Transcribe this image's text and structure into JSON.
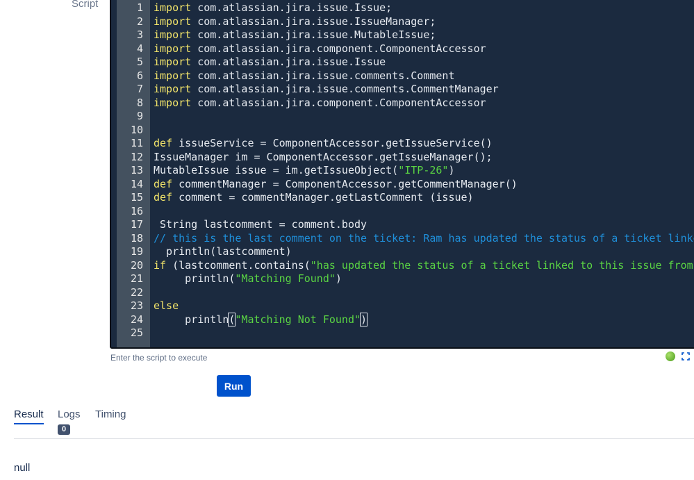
{
  "script_label": "Script",
  "editor": {
    "lines": [
      {
        "n": "1",
        "t": [
          [
            "kw",
            "import"
          ],
          [
            "pl",
            " com.atlassian.jira.issue.Issue;"
          ]
        ]
      },
      {
        "n": "2",
        "t": [
          [
            "kw",
            "import"
          ],
          [
            "pl",
            " com.atlassian.jira.issue.IssueManager;"
          ]
        ]
      },
      {
        "n": "3",
        "t": [
          [
            "kw",
            "import"
          ],
          [
            "pl",
            " com.atlassian.jira.issue.MutableIssue;"
          ]
        ]
      },
      {
        "n": "4",
        "t": [
          [
            "kw",
            "import"
          ],
          [
            "pl",
            " com.atlassian.jira.component.ComponentAccessor"
          ]
        ]
      },
      {
        "n": "5",
        "t": [
          [
            "kw",
            "import"
          ],
          [
            "pl",
            " com.atlassian.jira.issue.Issue"
          ]
        ]
      },
      {
        "n": "6",
        "t": [
          [
            "kw",
            "import"
          ],
          [
            "pl",
            " com.atlassian.jira.issue.comments.Comment"
          ]
        ]
      },
      {
        "n": "7",
        "t": [
          [
            "kw",
            "import"
          ],
          [
            "pl",
            " com.atlassian.jira.issue.comments.CommentManager"
          ]
        ]
      },
      {
        "n": "8",
        "t": [
          [
            "kw",
            "import"
          ],
          [
            "pl",
            " com.atlassian.jira.component.ComponentAccessor"
          ]
        ]
      },
      {
        "n": "9",
        "t": []
      },
      {
        "n": "10",
        "t": []
      },
      {
        "n": "11",
        "t": [
          [
            "kw",
            "def"
          ],
          [
            "pl",
            " issueService = ComponentAccessor.getIssueService()"
          ]
        ]
      },
      {
        "n": "12",
        "t": [
          [
            "pl",
            "IssueManager im = ComponentAccessor.getIssueManager();"
          ]
        ]
      },
      {
        "n": "13",
        "t": [
          [
            "pl",
            "MutableIssue issue = im.getIssueObject("
          ],
          [
            "str",
            "\"ITP-26\""
          ],
          [
            "pl",
            ")"
          ]
        ]
      },
      {
        "n": "14",
        "t": [
          [
            "kw",
            "def"
          ],
          [
            "pl",
            " commentManager = ComponentAccessor.getCommentManager()"
          ]
        ]
      },
      {
        "n": "15",
        "t": [
          [
            "kw",
            "def"
          ],
          [
            "pl",
            " comment = commentManager.getLastComment (issue)"
          ]
        ]
      },
      {
        "n": "16",
        "t": []
      },
      {
        "n": "17",
        "t": [
          [
            "pl",
            " String lastcomment = comment.body"
          ]
        ]
      },
      {
        "n": "18",
        "t": [
          [
            "cm",
            "// this is the last comment on the ticket: Ram has updated the status of a ticket linked to"
          ]
        ]
      },
      {
        "n": "19",
        "t": [
          [
            "pl",
            "  println(lastcomment)"
          ]
        ]
      },
      {
        "n": "20",
        "t": [
          [
            "kw",
            "if"
          ],
          [
            "pl",
            " (lastcomment.contains("
          ],
          [
            "str",
            "\"has updated the status of a ticket linked to this issue from [Ope"
          ]
        ]
      },
      {
        "n": "21",
        "t": [
          [
            "pl",
            "     println("
          ],
          [
            "str",
            "\"Matching Found\""
          ],
          [
            "pl",
            ")"
          ]
        ]
      },
      {
        "n": "22",
        "t": []
      },
      {
        "n": "23",
        "t": [
          [
            "kw",
            "else"
          ]
        ]
      },
      {
        "n": "24",
        "t": [
          [
            "pl",
            "     println"
          ],
          [
            "cursor",
            "("
          ],
          [
            "str",
            "\"Matching Not Found\""
          ],
          [
            "cursor",
            ")"
          ]
        ]
      },
      {
        "n": "25",
        "t": []
      }
    ]
  },
  "helper_text": "Enter the script to execute",
  "run_label": "Run",
  "tabs": [
    {
      "label": "Result",
      "active": true
    },
    {
      "label": "Logs",
      "active": false,
      "badge": "0"
    },
    {
      "label": "Timing",
      "active": false
    }
  ],
  "result_value": "null",
  "colors": {
    "editor_bg": "#1b2a3f",
    "keyword": "#f2e46a",
    "string": "#5ad443",
    "comment": "#1f8fd9",
    "accent": "#0052cc",
    "status": "#4a9b1b"
  },
  "icons": {
    "status": "status-dot-icon",
    "expand": "expand-icon"
  }
}
